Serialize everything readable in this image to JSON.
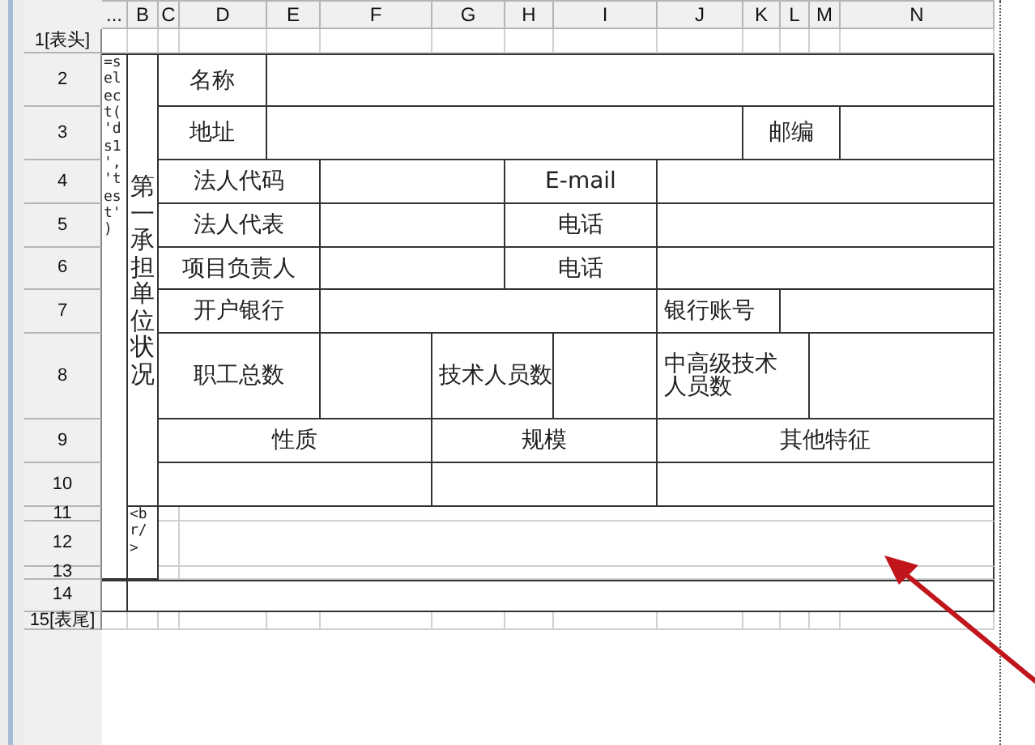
{
  "column_headers": [
    "...",
    "B",
    "C",
    "D",
    "E",
    "F",
    "G",
    "H",
    "I",
    "J",
    "K",
    "L",
    "M",
    "N"
  ],
  "row_headers": [
    "1[表头]",
    "2",
    "3",
    "4",
    "5",
    "6",
    "7",
    "8",
    "9",
    "10",
    "11",
    "12",
    "13",
    "14",
    "15[表尾]"
  ],
  "cells": [
    {
      "text": "=select('ds1','test')",
      "kind": "formula"
    },
    {
      "text": "第一承担单位状况",
      "kind": "vertical"
    },
    {
      "text": "名称",
      "kind": "label"
    },
    {
      "text": "地址",
      "kind": "label"
    },
    {
      "text": "邮编",
      "kind": "label"
    },
    {
      "text": "法人代码",
      "kind": "label"
    },
    {
      "text": "E-mail",
      "kind": "label"
    },
    {
      "text": "法人代表",
      "kind": "label"
    },
    {
      "text": "电话",
      "kind": "label"
    },
    {
      "text": "项目负责人",
      "kind": "label"
    },
    {
      "text": "电话",
      "kind": "label"
    },
    {
      "text": "开户银行",
      "kind": "label"
    },
    {
      "text": "银行账号",
      "kind": "wrap"
    },
    {
      "text": "职工总数",
      "kind": "label"
    },
    {
      "text": "技术人员数",
      "kind": "wrap"
    },
    {
      "text": "中高级技术人员数",
      "kind": "wrap"
    },
    {
      "text": "性质",
      "kind": "label"
    },
    {
      "text": "规模",
      "kind": "label"
    },
    {
      "text": "其他特征",
      "kind": "label"
    },
    {
      "text": "<br/>",
      "kind": "formula"
    }
  ]
}
